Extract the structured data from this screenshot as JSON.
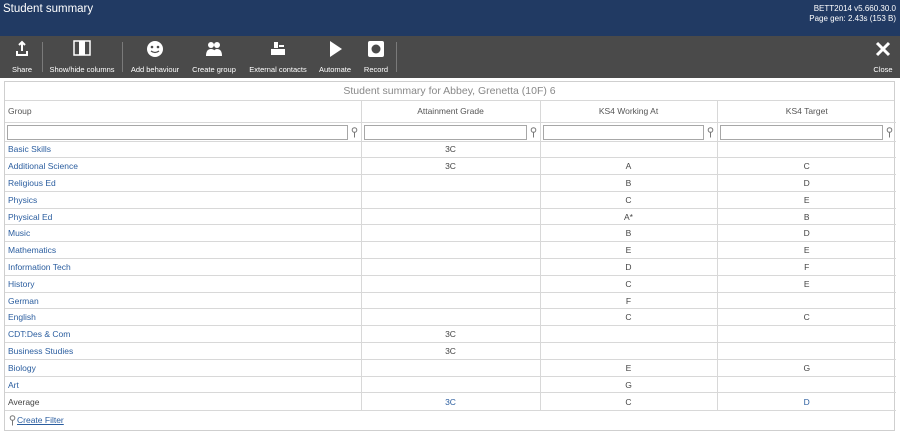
{
  "header": {
    "title": "Student summary",
    "version": "BETT2014 v5.660.30.0",
    "page_gen": "Page gen: 2.43s (153 B)"
  },
  "toolbar": {
    "share": "Share",
    "show_hide": "Show/hide columns",
    "add_behaviour": "Add behaviour",
    "create_group": "Create group",
    "external_contacts": "External contacts",
    "automate": "Automate",
    "record": "Record",
    "close": "Close"
  },
  "grid": {
    "caption": "Student summary for Abbey, Grenetta (10F) 6",
    "columns": [
      "Group",
      "Attainment Grade",
      "KS4 Working At",
      "KS4 Target"
    ],
    "rows": [
      [
        "Basic Skills",
        "3C",
        "",
        ""
      ],
      [
        "Additional Science",
        "3C",
        "A",
        "C"
      ],
      [
        "Religious Ed",
        "",
        "B",
        "D"
      ],
      [
        "Physics",
        "",
        "C",
        "E"
      ],
      [
        "Physical Ed",
        "",
        "A*",
        "B"
      ],
      [
        "Music",
        "",
        "B",
        "D"
      ],
      [
        "Mathematics",
        "",
        "E",
        "E"
      ],
      [
        "Information Tech",
        "",
        "D",
        "F"
      ],
      [
        "History",
        "",
        "C",
        "E"
      ],
      [
        "German",
        "",
        "F",
        ""
      ],
      [
        "English",
        "",
        "C",
        "C"
      ],
      [
        "CDT:Des & Com",
        "3C",
        "",
        ""
      ],
      [
        "Business Studies",
        "3C",
        "",
        ""
      ],
      [
        "Biology",
        "",
        "E",
        "G"
      ],
      [
        "Art",
        "",
        "G",
        ""
      ]
    ],
    "average": [
      "Average",
      "3C",
      "C",
      "D"
    ],
    "create_filter": "Create Filter"
  }
}
